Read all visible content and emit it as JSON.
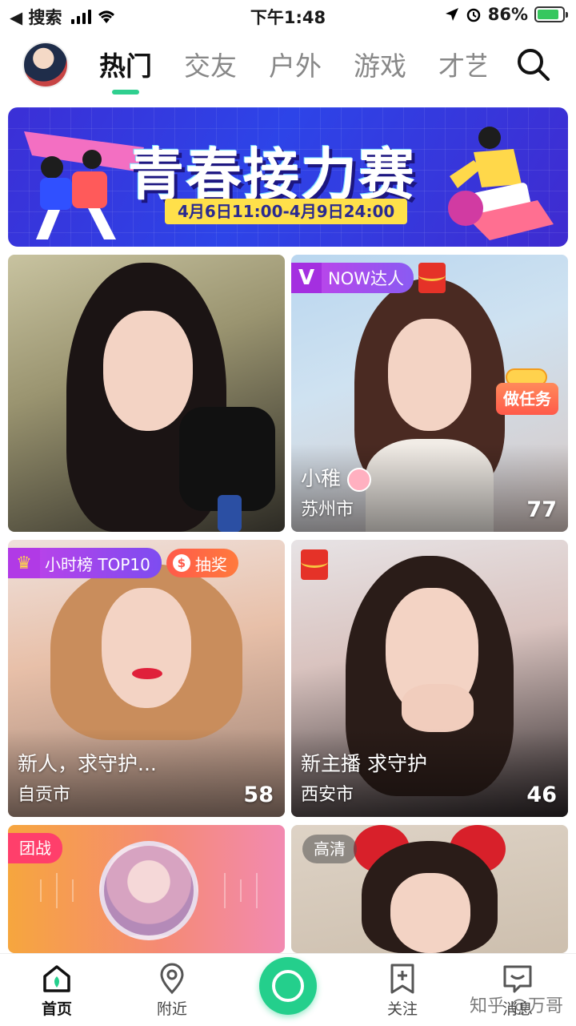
{
  "status_bar": {
    "back_label": "◀ 搜索",
    "time": "下午1:48",
    "battery": "86%"
  },
  "nav": {
    "tabs": [
      {
        "label": "热门"
      },
      {
        "label": "交友"
      },
      {
        "label": "户外"
      },
      {
        "label": "游戏"
      },
      {
        "label": "才艺"
      }
    ],
    "active_tab": "热门"
  },
  "banner": {
    "title": "青春接力赛",
    "date": "4月6日11:00-4月9日24:00"
  },
  "cards": [
    {
      "title": "",
      "city": "",
      "count": ""
    },
    {
      "badge": "NOW达人",
      "task": "做任务",
      "title": "小稚",
      "city": "苏州市",
      "count": "77"
    },
    {
      "badge": "小时榜 TOP10",
      "lottery": "抽奖",
      "title": "新人，求守护...",
      "city": "自贡市",
      "count": "58"
    },
    {
      "title": "新主播 求守护",
      "city": "西安市",
      "count": "46"
    },
    {
      "tag": "团战"
    },
    {
      "tag": "高清"
    }
  ],
  "bottom_nav": {
    "items": [
      {
        "label": "首页"
      },
      {
        "label": "附近"
      },
      {
        "label": "关注"
      },
      {
        "label": "消息"
      }
    ]
  },
  "watermark": "知乎 @万哥",
  "colors": {
    "accent": "#24cf8c",
    "badge_purple": "#b13ae6",
    "lottery_red": "#ff5a4a",
    "banner_blue": "#2d44e8"
  },
  "icons": [
    "search-icon",
    "home-icon",
    "location-pin-icon",
    "bookmark-plus-icon",
    "message-icon",
    "crown-icon",
    "red-packet-icon"
  ]
}
